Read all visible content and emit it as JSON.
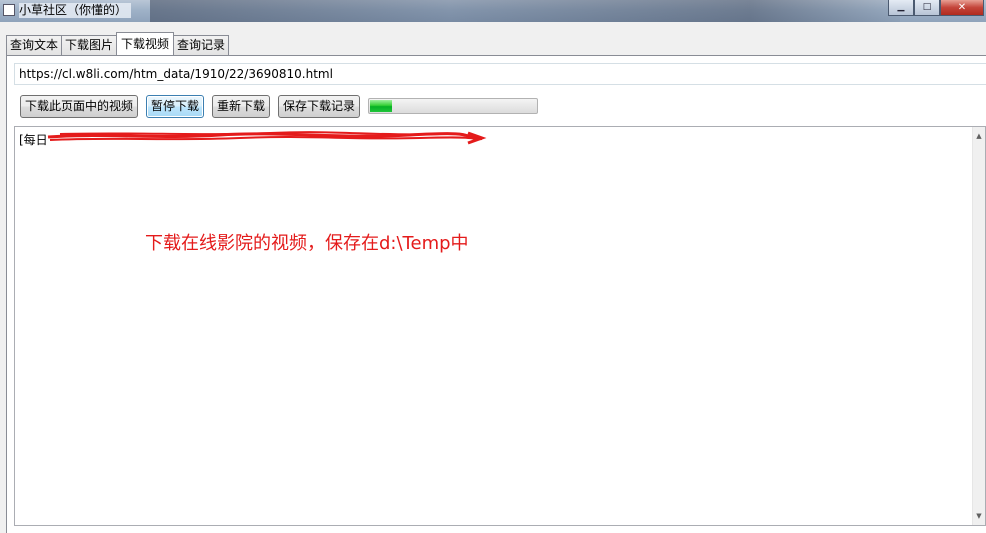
{
  "window": {
    "title": "小草社区（你懂的）",
    "buttons": {
      "minimize": "▁",
      "maximize": "□",
      "close": "✕"
    }
  },
  "tabs": [
    {
      "label": "查询文本",
      "active": false
    },
    {
      "label": "下载图片",
      "active": false
    },
    {
      "label": "下载视频",
      "active": true
    },
    {
      "label": "查询记录",
      "active": false
    }
  ],
  "url": {
    "value": "https://cl.w8li.com/htm_data/1910/22/3690810.html"
  },
  "buttons": {
    "download": "下载此页面中的视频",
    "pause": "暂停下载",
    "redownload": "重新下载",
    "save_log": "保存下载记录"
  },
  "progress": {
    "value": 0.14,
    "color": "#06b025"
  },
  "log": {
    "first_line": "[每日"
  },
  "annotation": {
    "text": "下载在线影院的视频，保存在d:\\Temp中",
    "color": "#e41b1b"
  },
  "colors": {
    "accent": "#3c7fb1",
    "annotation": "#e41b1b"
  }
}
